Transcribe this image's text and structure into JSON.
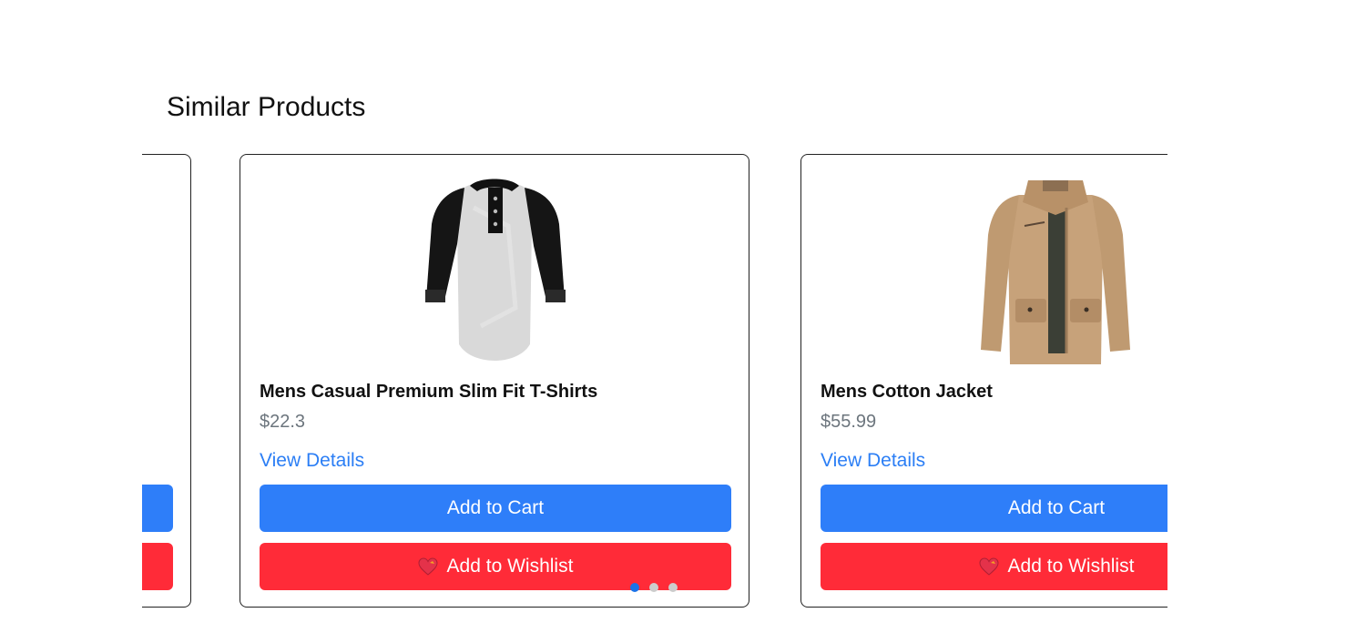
{
  "section": {
    "title": "Similar Products"
  },
  "colors": {
    "primary": "#2e7ef9",
    "danger": "#ff2b38",
    "link": "#2b7ef5",
    "price": "#6c757d"
  },
  "products": [
    {
      "name": "",
      "price": "",
      "details_label": "",
      "cart_label": "",
      "wishlist_label": ""
    },
    {
      "name": "Mens Casual Premium Slim Fit T-Shirts",
      "price": "$22.3",
      "details_label": "View Details",
      "cart_label": "Add to Cart",
      "wishlist_label": "Add to Wishlist",
      "image_icon": "raglan-henley-shirt-icon"
    },
    {
      "name": "Mens Cotton Jacket",
      "price": "$55.99",
      "details_label": "View Details",
      "cart_label": "Add to Cart",
      "wishlist_label": "Add to Wishlist",
      "image_icon": "khaki-jacket-icon"
    }
  ],
  "carousel": {
    "slide_count": 3,
    "active_index": 0
  }
}
